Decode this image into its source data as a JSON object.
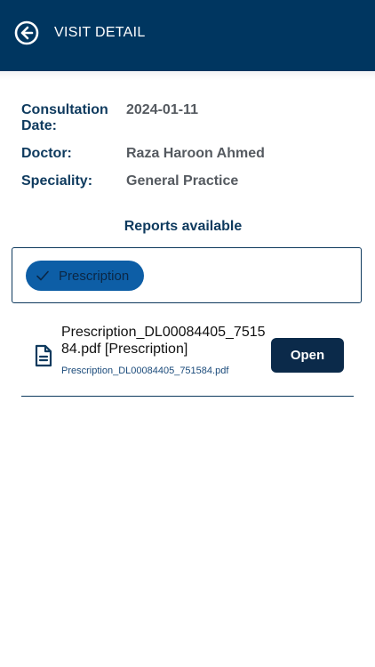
{
  "header": {
    "title": "VISIT DETAIL",
    "back_icon": "arrow-left-circle-icon"
  },
  "details": {
    "consultation_date_label": "Consultation Date:",
    "consultation_date_value": "2024-01-11",
    "doctor_label": "Doctor:",
    "doctor_value": "Raza Haroon Ahmed",
    "speciality_label": "Speciality:",
    "speciality_value": "General Practice"
  },
  "reports": {
    "heading": "Reports available",
    "filter_chip": {
      "label": "Prescription",
      "selected": true,
      "icon": "check-icon"
    },
    "files": [
      {
        "title": "Prescription_DL00084405_751584.pdf [Prescription]",
        "filename": "Prescription_DL00084405_751584.pdf",
        "icon": "document-icon",
        "open_label": "Open"
      }
    ]
  },
  "colors": {
    "header_bg": "#003660",
    "label_text": "#0e3a5e",
    "value_text": "#555a60",
    "chip_bg": "#0d5ea6",
    "button_bg": "#0b2a4a"
  }
}
